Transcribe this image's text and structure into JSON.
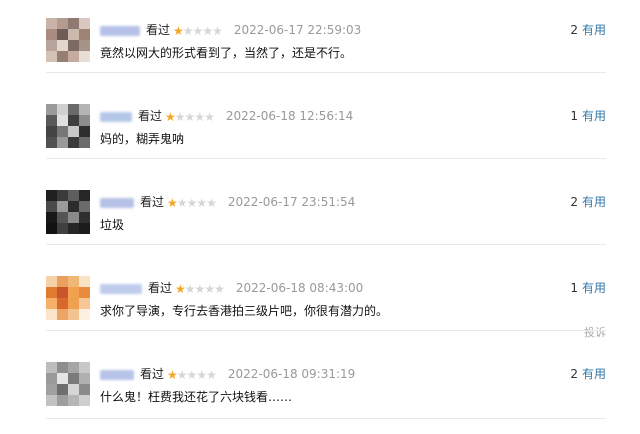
{
  "colors": {
    "star_on": "#f5a623",
    "star_off": "#d6d6d6",
    "link": "#3377aa",
    "time": "#999999"
  },
  "comments": [
    {
      "status": "看过",
      "rating_stars": 1,
      "rating_max": 5,
      "time": "2022-06-17 22:59:03",
      "content": "竟然以网大的形式看到了，当然了，还是不行。",
      "votes": "2",
      "useful_label": "有用",
      "avatar_colors": [
        "#c9b2a8",
        "#b49a8f",
        "#8f7a73",
        "#d8c8bf",
        "#a88c7f",
        "#6e5c57",
        "#cbb9ac",
        "#9c8376",
        "#b8a49a",
        "#e2d6cd",
        "#7d6a63",
        "#a79488",
        "#d5c2b6",
        "#957e72",
        "#c4ab9e",
        "#e8ded6"
      ]
    },
    {
      "status": "看过",
      "rating_stars": 1,
      "rating_max": 5,
      "time": "2022-06-18 12:56:14",
      "content": "妈的，糊弄鬼呐",
      "votes": "1",
      "useful_label": "有用",
      "avatar_colors": [
        "#9a9a9a",
        "#d0d0d0",
        "#6a6a6a",
        "#b4b4b4",
        "#5a5a5a",
        "#e0e0e0",
        "#3f3f3f",
        "#8c8c8c",
        "#444444",
        "#777777",
        "#c8c8c8",
        "#2e2e2e",
        "#505050",
        "#999999",
        "#3a3a3a",
        "#6c6c6c"
      ]
    },
    {
      "status": "看过",
      "rating_stars": 1,
      "rating_max": 5,
      "time": "2022-06-17 23:51:54",
      "content": "垃圾",
      "votes": "2",
      "useful_label": "有用",
      "avatar_colors": [
        "#1f1f1f",
        "#3a3a3a",
        "#5e5e5e",
        "#262626",
        "#4a4a4a",
        "#9a9a9a",
        "#2c2c2c",
        "#6b6b6b",
        "#181818",
        "#555555",
        "#8a8a8a",
        "#303030",
        "#121212",
        "#404040",
        "#262626",
        "#1c1c1c"
      ]
    },
    {
      "status": "看过",
      "rating_stars": 1,
      "rating_max": 5,
      "time": "2022-06-18 08:43:00",
      "content": "求你了导演，专行去香港拍三级片吧，你很有潜力的。",
      "votes": "1",
      "useful_label": "有用",
      "report_label": "投诉",
      "avatar_colors": [
        "#f6d2a8",
        "#e9a05c",
        "#f0b877",
        "#fae2c5",
        "#e07a2e",
        "#c9562a",
        "#f2a24e",
        "#e88c3c",
        "#f4b069",
        "#d9682c",
        "#efa050",
        "#f7c896",
        "#fbe4c9",
        "#eda466",
        "#f3c28e",
        "#fdf0e0"
      ]
    },
    {
      "status": "看过",
      "rating_stars": 1,
      "rating_max": 5,
      "time": "2022-06-18 09:31:19",
      "content": "什么鬼！枉费我还花了六块钱看……",
      "votes": "2",
      "useful_label": "有用",
      "avatar_colors": [
        "#bdbdbd",
        "#8e8e8e",
        "#a6a6a6",
        "#c8c8c8",
        "#9a9a9a",
        "#e4e4e4",
        "#7a7a7a",
        "#b0b0b0",
        "#a0a0a0",
        "#6e6e6e",
        "#d6d6d6",
        "#8a8a8a",
        "#c2c2c2",
        "#9e9e9e",
        "#b6b6b6",
        "#cfcfcf"
      ]
    }
  ]
}
